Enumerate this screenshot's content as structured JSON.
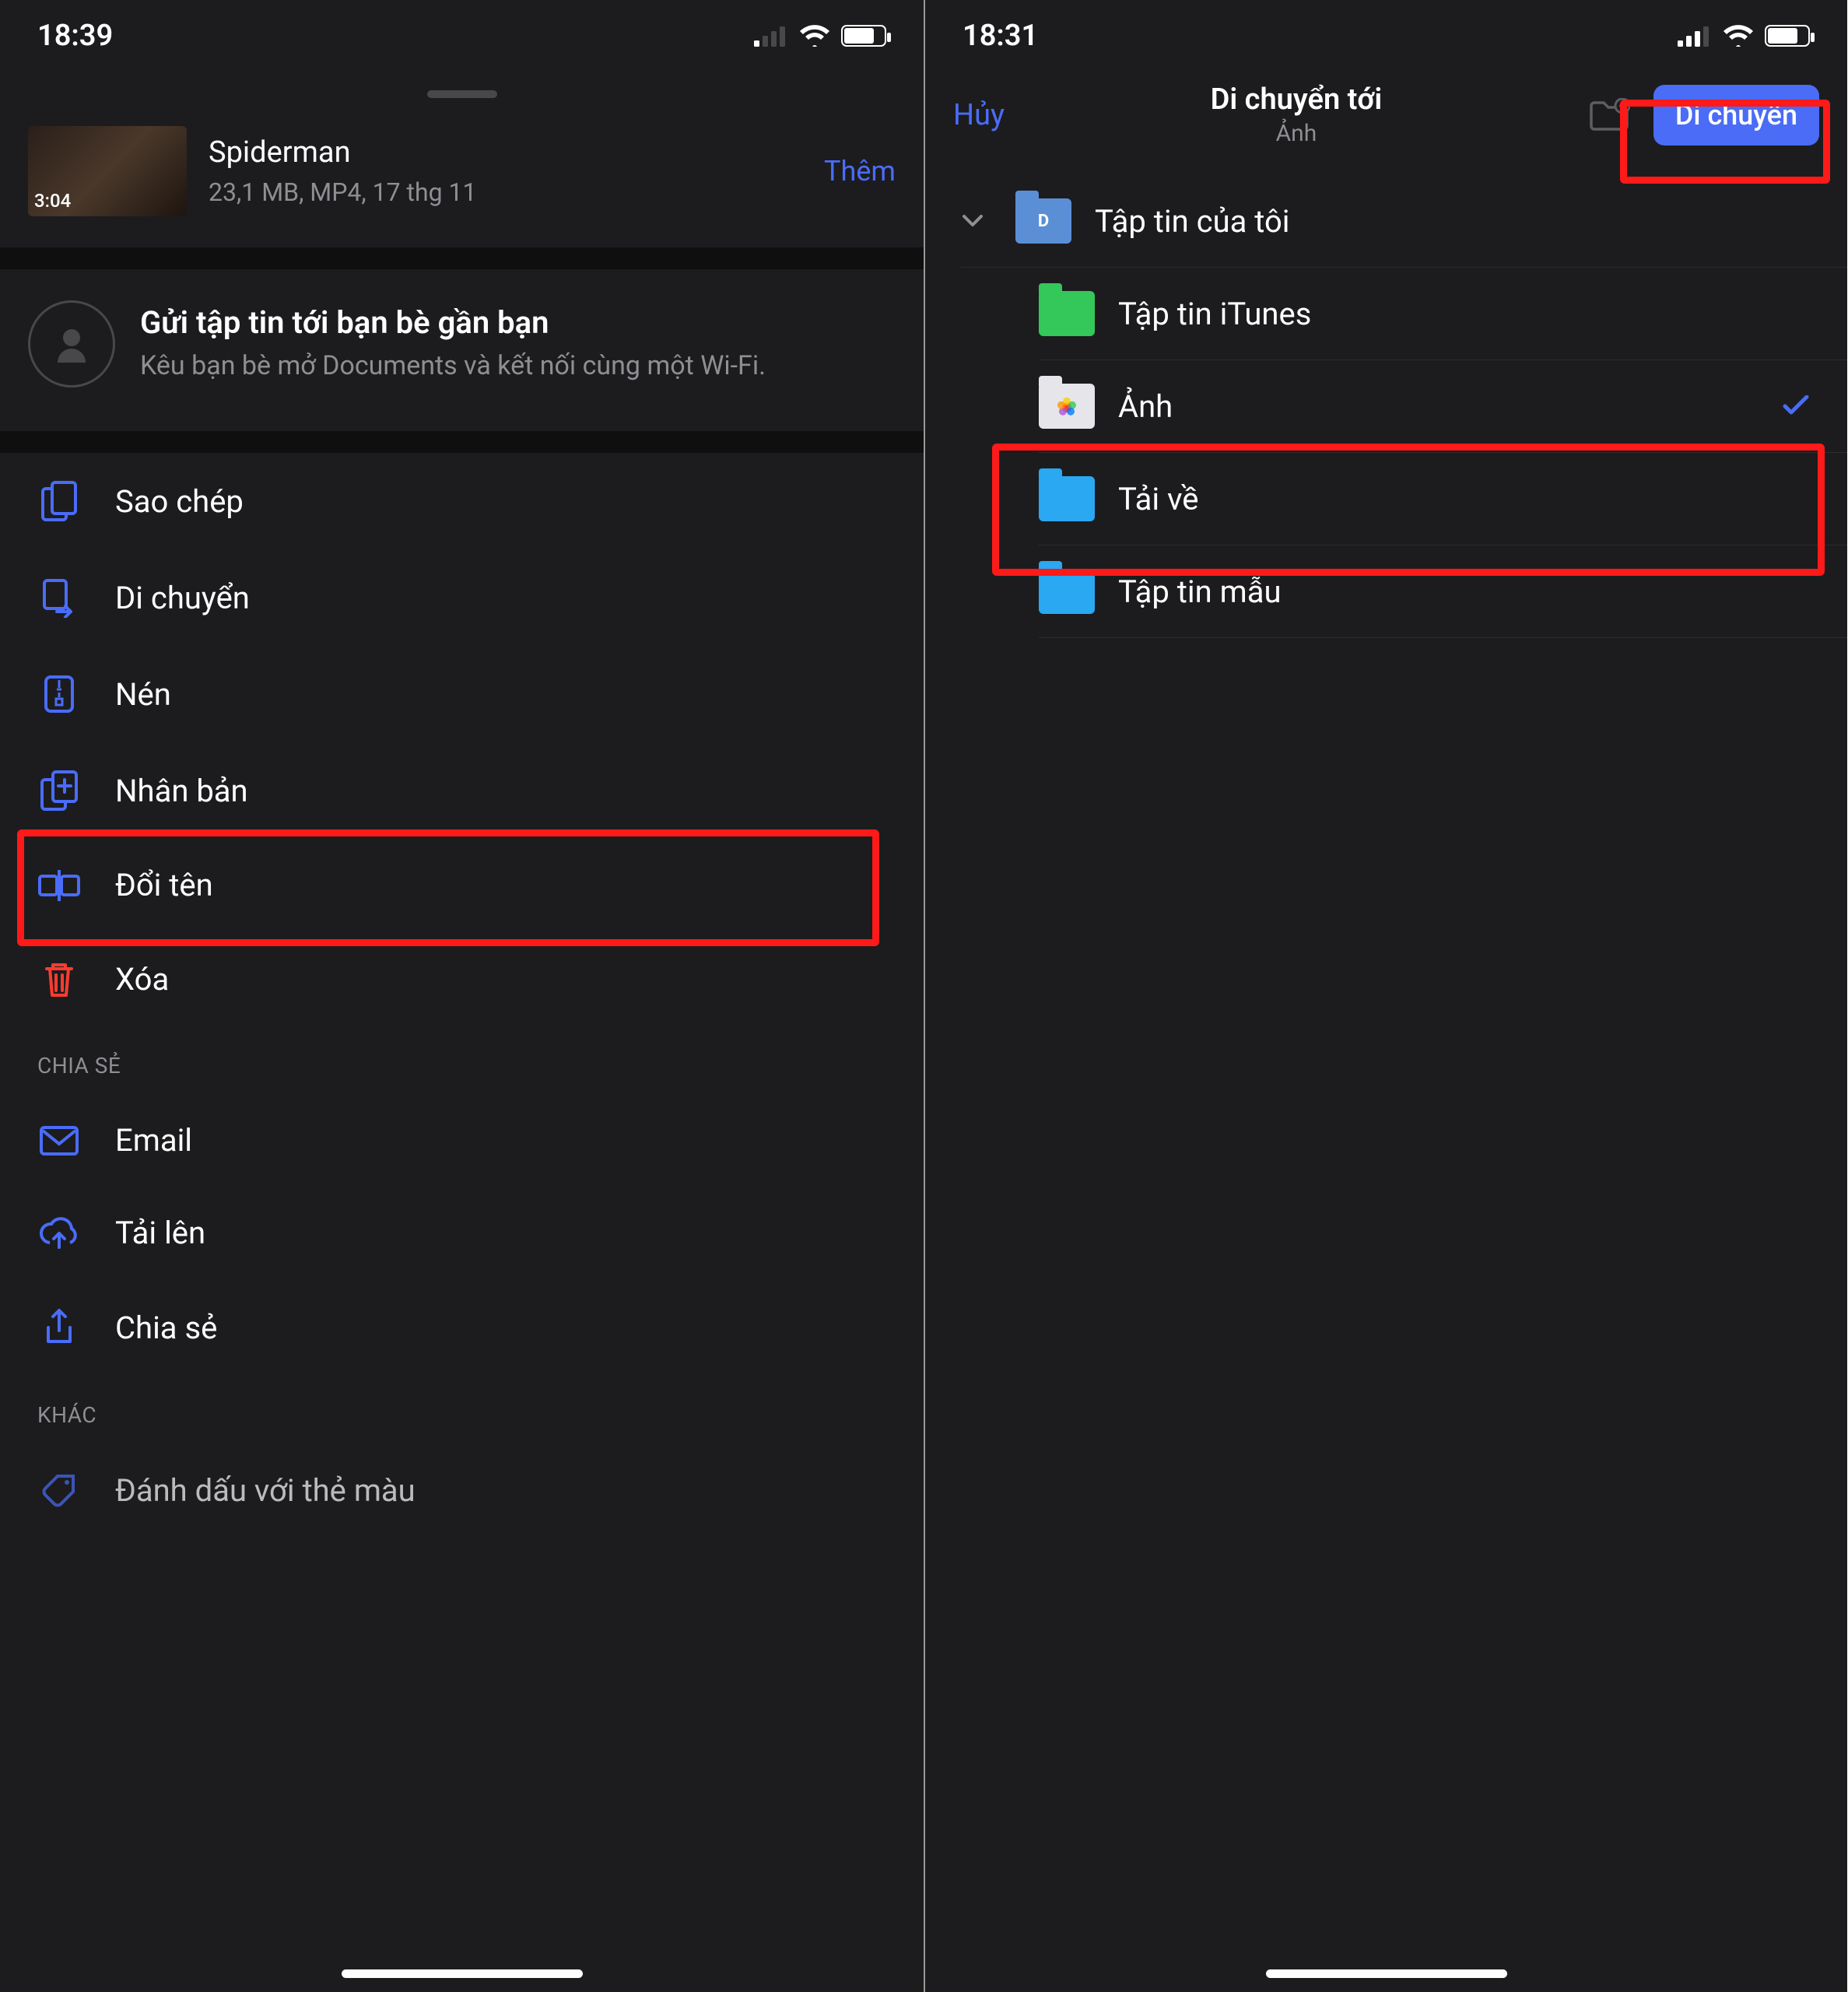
{
  "left": {
    "time": "18:39",
    "file": {
      "duration": "3:04",
      "title": "Spiderman",
      "subtitle": "23,1 MB, MP4, 17 thg 11",
      "more": "Thêm"
    },
    "share_nearby": {
      "title": "Gửi tập tin tới bạn bè gần bạn",
      "subtitle": "Kêu bạn bè mở Documents và kết nối cùng một Wi-Fi."
    },
    "actions": {
      "copy": "Sao chép",
      "move": "Di chuyển",
      "compress": "Nén",
      "duplicate": "Nhân bản",
      "rename": "Đổi tên",
      "delete": "Xóa"
    },
    "section_share": "CHIA SẺ",
    "share_actions": {
      "email": "Email",
      "upload": "Tải lên",
      "share": "Chia sẻ"
    },
    "section_other": "KHÁC",
    "other_actions": {
      "tag": "Đánh dấu với thẻ màu"
    }
  },
  "right": {
    "time": "18:31",
    "nav": {
      "cancel": "Hủy",
      "title": "Di chuyển tới",
      "subtitle": "Ảnh",
      "move": "Di chuyển"
    },
    "tree": {
      "root": "Tập tin của tôi",
      "itunes": "Tập tin iTunes",
      "photos": "Ảnh",
      "downloads": "Tải về",
      "samples": "Tập tin mẫu"
    }
  }
}
